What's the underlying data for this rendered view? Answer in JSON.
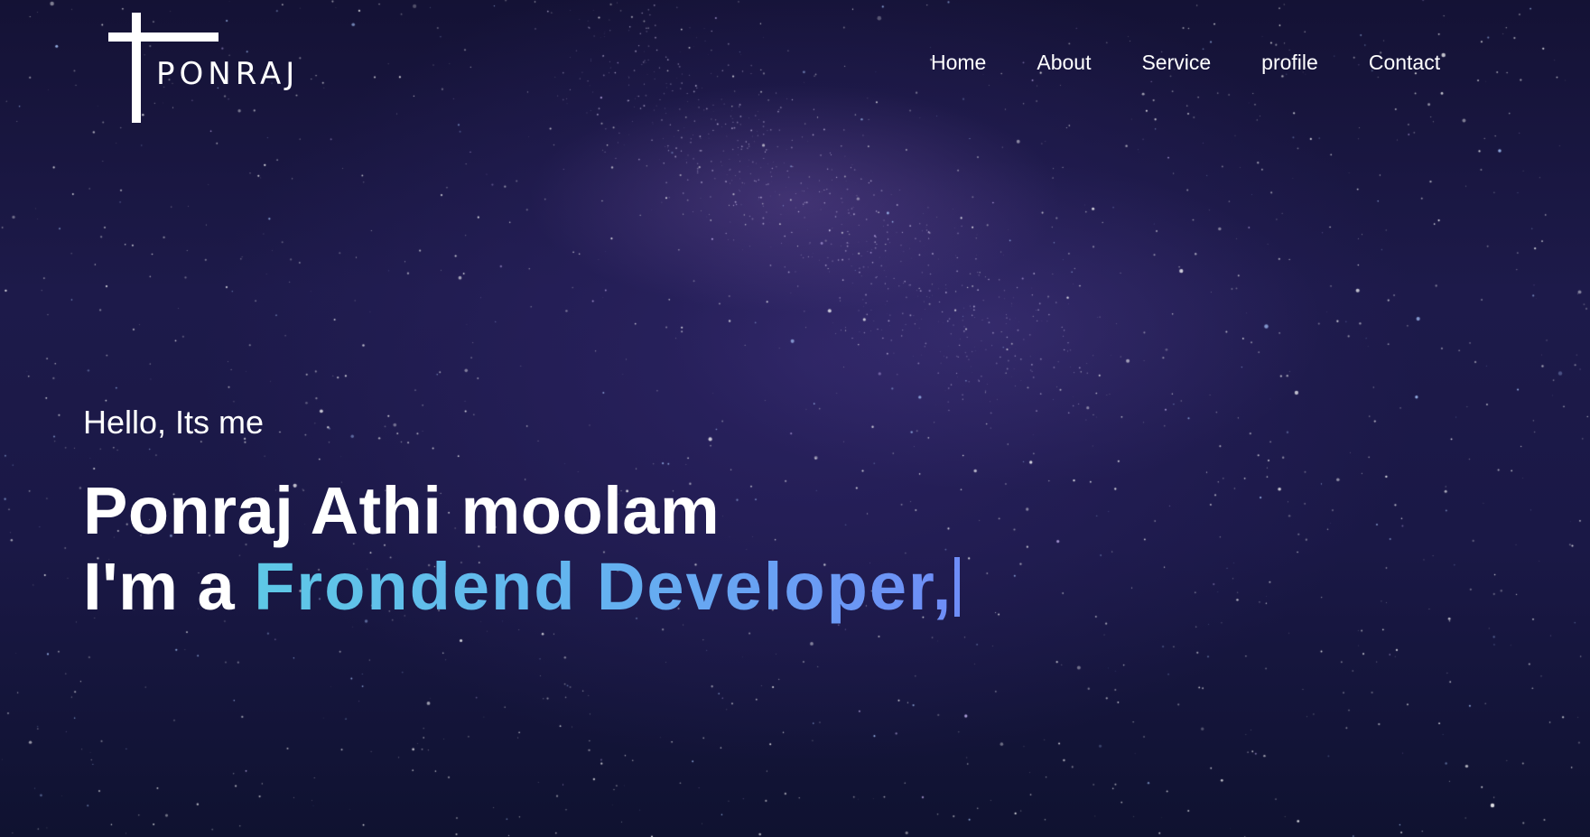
{
  "brand": {
    "name": "PONRAJ"
  },
  "nav": {
    "items": [
      {
        "label": "Home"
      },
      {
        "label": "About"
      },
      {
        "label": "Service"
      },
      {
        "label": "profile"
      },
      {
        "label": "Contact"
      }
    ]
  },
  "hero": {
    "greeting": "Hello, Its me",
    "name": "Ponraj Athi moolam",
    "role_prefix": "I'm a ",
    "role_typed": "Frondend Developer,"
  },
  "colors": {
    "background": "#1d1a4a",
    "text": "#ffffff",
    "gradient_start": "#5ec8e6",
    "gradient_end": "#6e8df7"
  }
}
